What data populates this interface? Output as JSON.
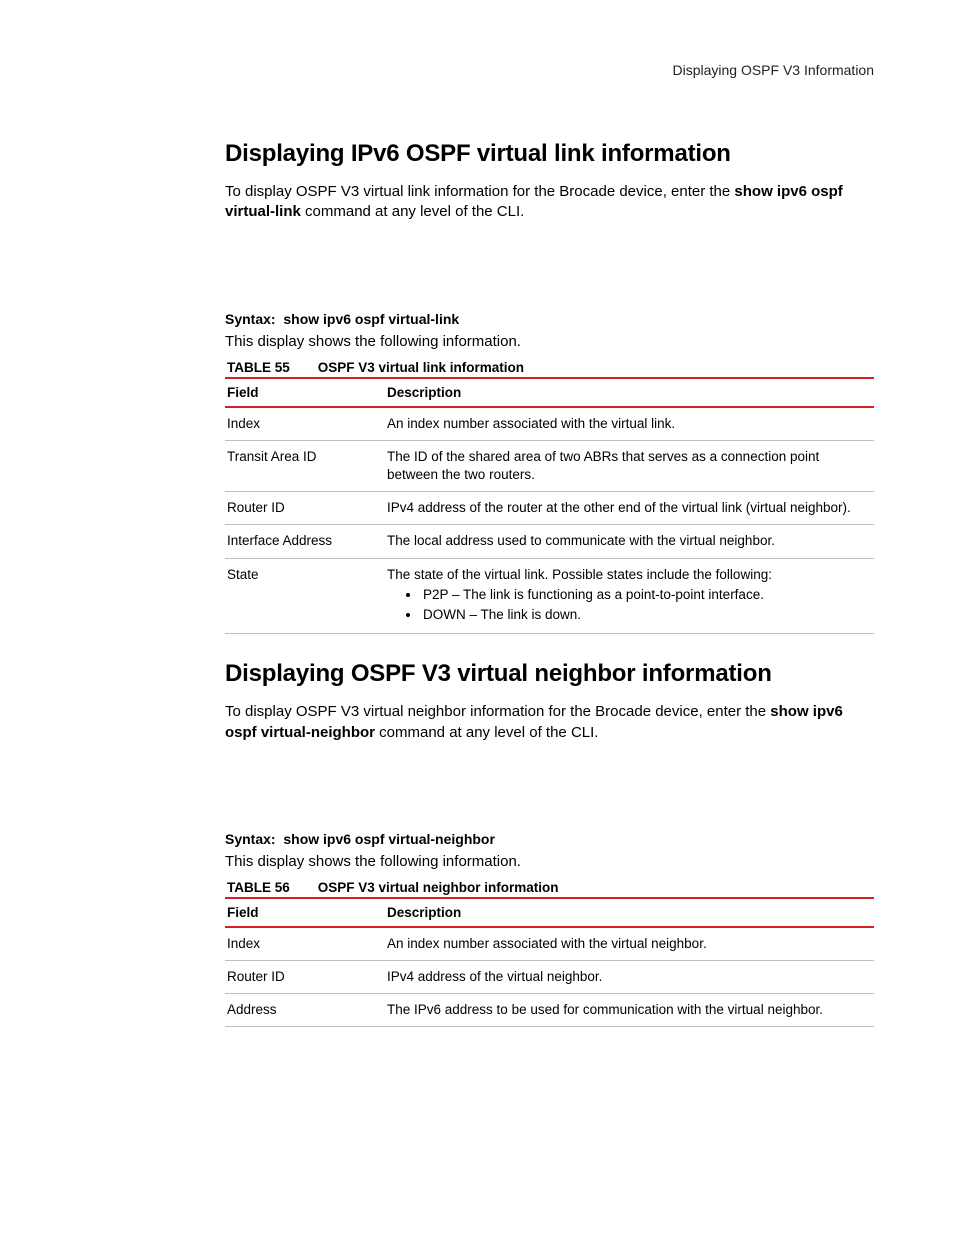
{
  "header": {
    "running": "Displaying OSPF V3 Information"
  },
  "section1": {
    "heading": "Displaying IPv6 OSPF virtual link information",
    "intro_pre": "To display OSPF V3 virtual link information for the Brocade device, enter the ",
    "intro_bold": "show ipv6 ospf virtual-link",
    "intro_post": " command at any level of the CLI.",
    "syntax_label": "Syntax:",
    "syntax_cmd": "show ipv6 ospf virtual-link",
    "display_lead": "This display shows the following information.",
    "table": {
      "cap_label": "TABLE 55",
      "cap_title": "OSPF V3 virtual link information",
      "head_field": "Field",
      "head_desc": "Description",
      "rows": [
        {
          "field": "Index",
          "desc": "An index number associated with the virtual link."
        },
        {
          "field": "Transit Area ID",
          "desc": "The ID of the shared area of two ABRs that serves as a connection point between the two routers."
        },
        {
          "field": "Router ID",
          "desc": "IPv4 address of the router at the other end of the virtual link (virtual neighbor)."
        },
        {
          "field": "Interface Address",
          "desc": "The local address used to communicate with the virtual neighbor."
        }
      ],
      "state_row": {
        "field": "State",
        "lead": "The state of the virtual link. Possible states include the following:",
        "bullets": [
          "P2P – The link is functioning as a point-to-point interface.",
          "DOWN – The link is down."
        ]
      }
    }
  },
  "section2": {
    "heading": "Displaying OSPF V3 virtual neighbor information",
    "intro_pre": "To display OSPF V3 virtual neighbor information for the Brocade device, enter the ",
    "intro_bold": "show ipv6 ospf virtual-neighbor",
    "intro_post": " command at any level of the CLI.",
    "syntax_label": "Syntax:",
    "syntax_cmd": "show ipv6 ospf virtual-neighbor",
    "display_lead": "This display shows the following information.",
    "table": {
      "cap_label": "TABLE 56",
      "cap_title": "OSPF V3 virtual neighbor information",
      "head_field": "Field",
      "head_desc": "Description",
      "rows": [
        {
          "field": "Index",
          "desc": "An index number associated with the virtual neighbor."
        },
        {
          "field": "Router ID",
          "desc": "IPv4 address of the virtual neighbor."
        },
        {
          "field": "Address",
          "desc": "The IPv6 address to be used for communication with the virtual neighbor."
        }
      ]
    }
  }
}
